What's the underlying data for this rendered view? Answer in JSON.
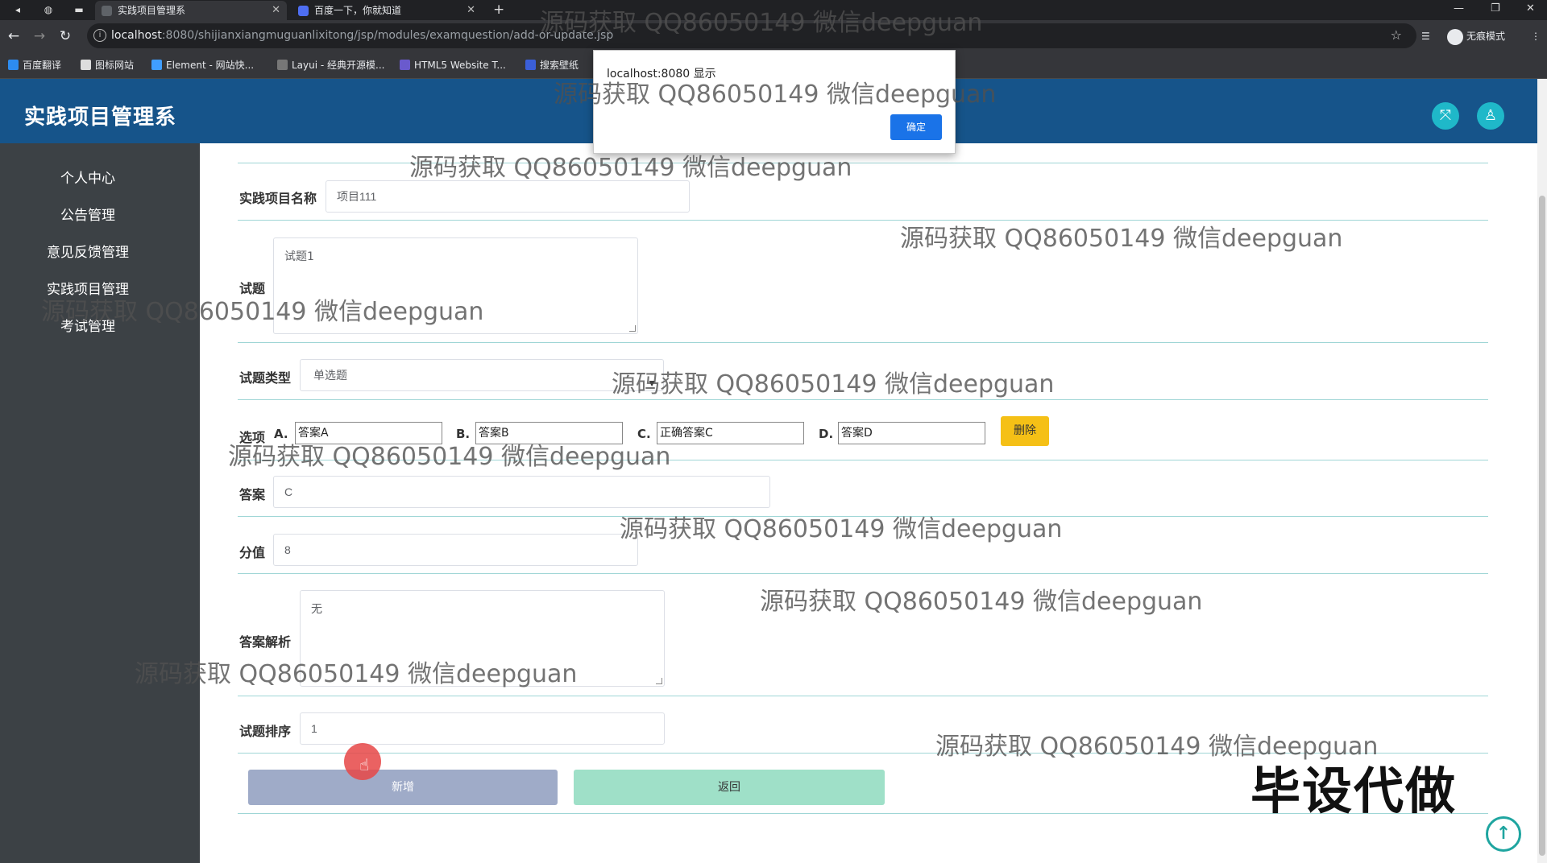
{
  "browser": {
    "tabs": [
      {
        "title": "实践项目管理系"
      },
      {
        "title": "百度一下，你就知道"
      }
    ],
    "new_tab": "+",
    "url_host": "localhost",
    "url_path": ":8080/shijianxiangmuguanlixitong/jsp/modules/examquestion/add-or-update.jsp",
    "incognito_label": "无痕模式",
    "bookmarks": [
      "百度翻译",
      "图标网站",
      "Element - 网站快...",
      "Layui - 经典开源模...",
      "HTML5 Website T...",
      "搜索壁纸"
    ]
  },
  "dialog": {
    "message": "localhost:8080 显示",
    "ok_label": "确定"
  },
  "header": {
    "title": "实践项目管理系"
  },
  "sidebar": {
    "items": [
      "个人中心",
      "公告管理",
      "意见反馈管理",
      "实践项目管理",
      "考试管理"
    ]
  },
  "form": {
    "project_name": {
      "label": "实践项目名称",
      "value": "项目111"
    },
    "question": {
      "label": "试题",
      "value": "试题1"
    },
    "question_type": {
      "label": "试题类型",
      "value": "单选题"
    },
    "options": {
      "label": "选项",
      "items": [
        {
          "letter": "A.",
          "value": "答案A"
        },
        {
          "letter": "B.",
          "value": "答案B"
        },
        {
          "letter": "C.",
          "value": "正确答案C"
        },
        {
          "letter": "D.",
          "value": "答案D"
        }
      ],
      "delete_label": "删除"
    },
    "answer": {
      "label": "答案",
      "value": "C"
    },
    "score": {
      "label": "分值",
      "value": "8"
    },
    "analysis": {
      "label": "答案解析",
      "value": "无"
    },
    "order": {
      "label": "试题排序",
      "value": "1"
    },
    "submit_label": "新增",
    "back_label": "返回"
  },
  "watermark": {
    "text": "源码获取 QQ86050149 微信deepguan",
    "big_text": "毕设代做"
  },
  "colors": {
    "header": "#16548a",
    "sidebar": "#3c4145",
    "divider": "#9fd6d6",
    "delete_button": "#f5c016",
    "submit_button": "#9fabc8",
    "back_button": "#9fe0c8"
  }
}
